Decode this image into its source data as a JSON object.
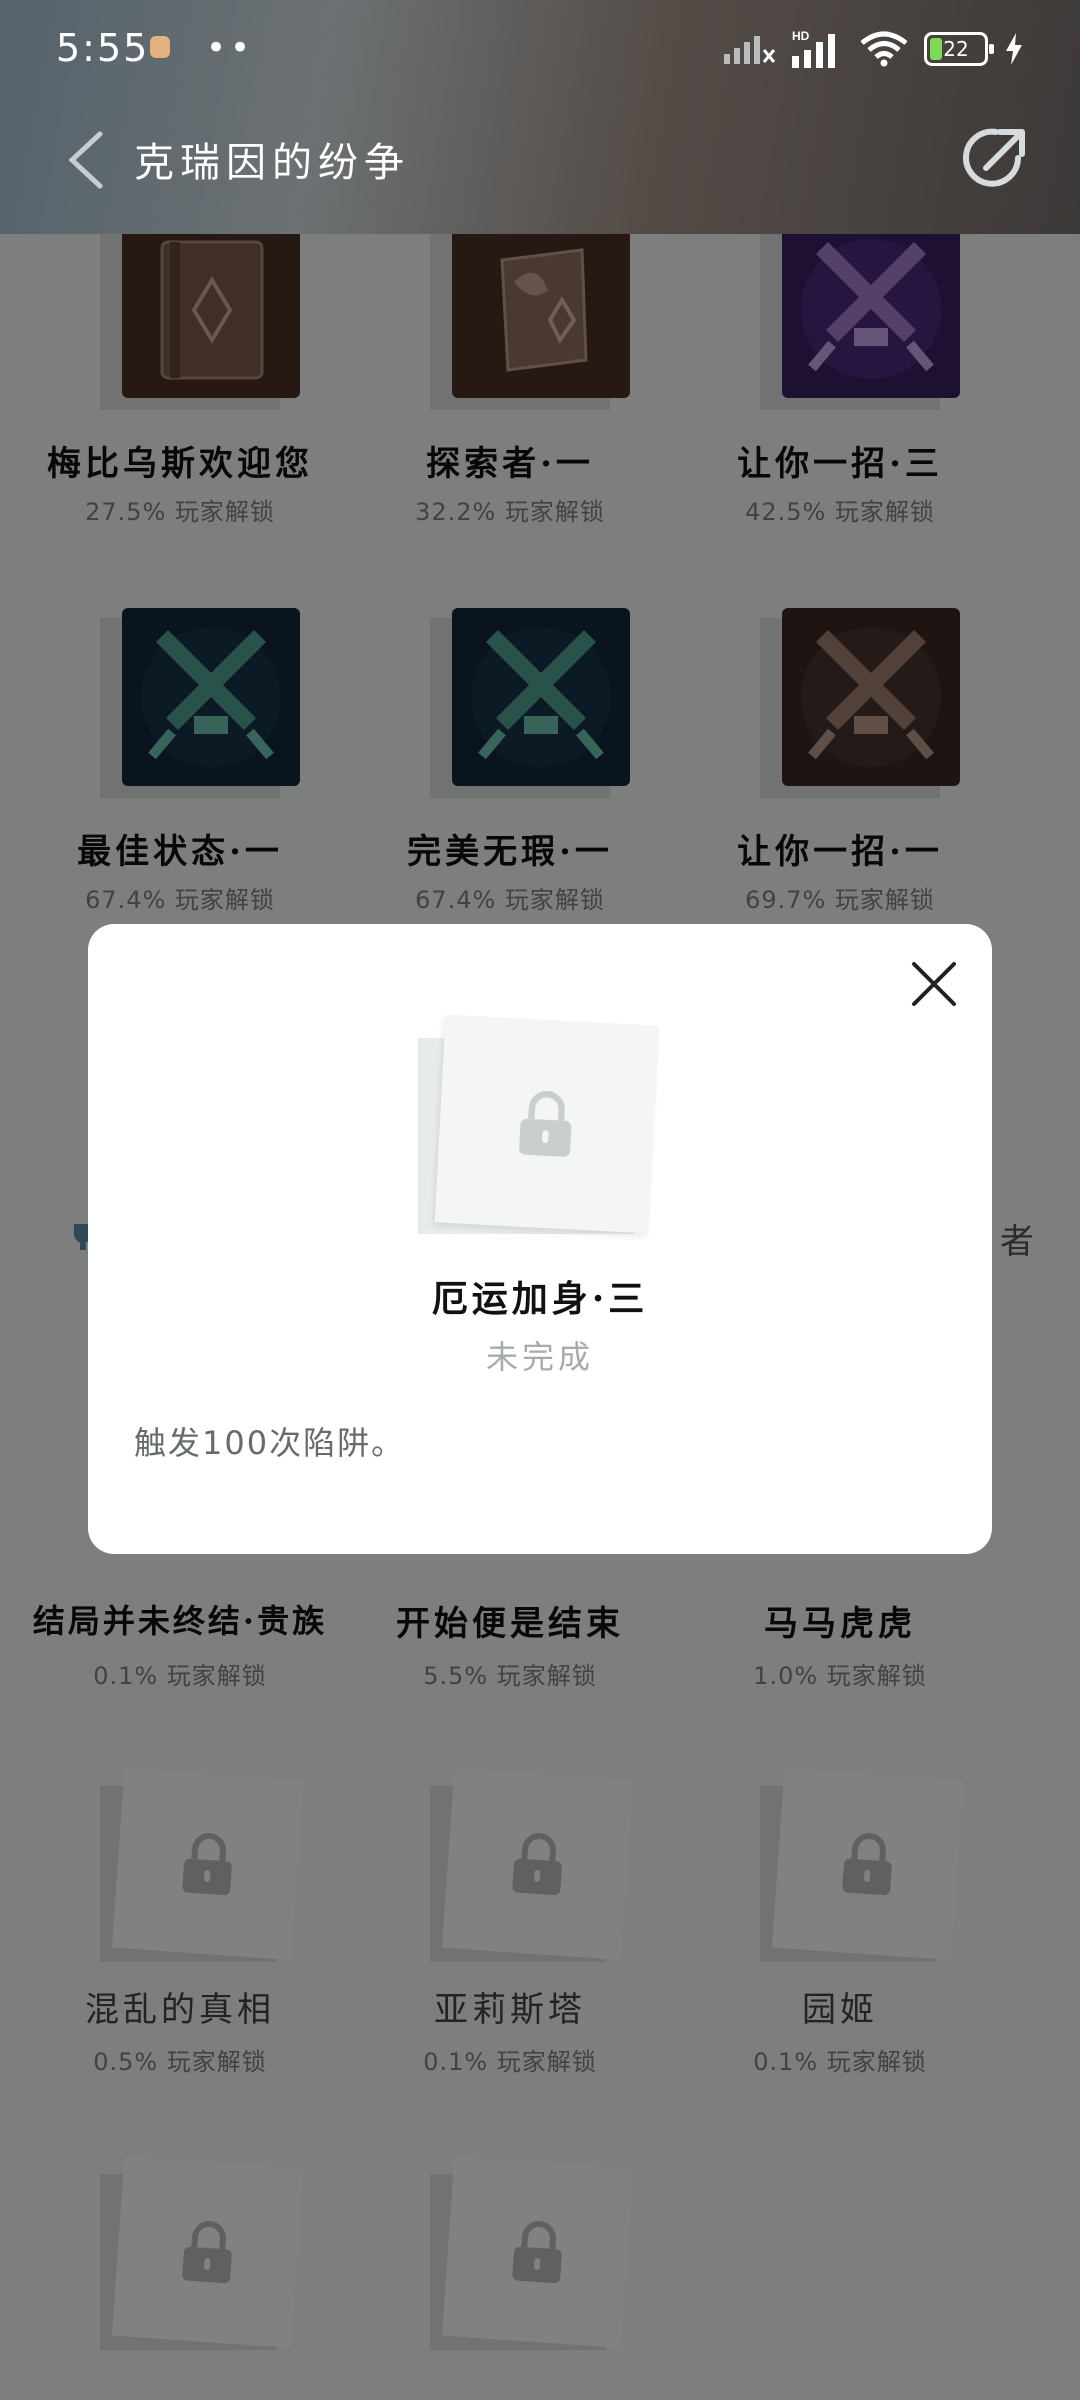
{
  "status_bar": {
    "time": "5:55",
    "dots": "••",
    "hd_label": "HD",
    "battery": "22"
  },
  "header": {
    "title": "克瑞因的纷争",
    "back_icon": "chevron-left-icon",
    "share_icon": "share-icon"
  },
  "achievements": [
    {
      "name": "梅比乌斯欢迎您",
      "percent": "27.5% 玩家解锁",
      "icon": "book-icon",
      "state": "unlocked",
      "color": "#4a3128"
    },
    {
      "name": "探索者·一",
      "percent": "32.2% 玩家解锁",
      "icon": "scroll-icon",
      "state": "unlocked",
      "color": "#4a3128"
    },
    {
      "name": "让你一招·三",
      "percent": "42.5% 玩家解锁",
      "icon": "crossed-swords-icon",
      "state": "unlocked",
      "color": "#3a1f63"
    },
    {
      "name": "最佳状态·一",
      "percent": "67.4% 玩家解锁",
      "icon": "crossed-swords-icon",
      "state": "unlocked",
      "color": "#12283a"
    },
    {
      "name": "完美无瑕·一",
      "percent": "67.4% 玩家解锁",
      "icon": "crossed-swords-icon",
      "state": "unlocked",
      "color": "#12283a"
    },
    {
      "name": "让你一招·一",
      "percent": "69.7% 玩家解锁",
      "icon": "crossed-swords-icon",
      "state": "unlocked",
      "color": "#3a2a24"
    },
    {
      "name": "结局并未终结·贵族",
      "percent": "0.1% 玩家解锁",
      "icon": "lock-icon",
      "state": "locked"
    },
    {
      "name": "开始便是结束",
      "percent": "5.5% 玩家解锁",
      "icon": "lock-icon",
      "state": "locked"
    },
    {
      "name": "马马虎虎",
      "percent": "1.0% 玩家解锁",
      "icon": "lock-icon",
      "state": "locked"
    },
    {
      "name": "混乱的真相",
      "percent": "0.5% 玩家解锁",
      "icon": "lock-icon",
      "state": "locked"
    },
    {
      "name": "亚莉斯塔",
      "percent": "0.1% 玩家解锁",
      "icon": "lock-icon",
      "state": "locked"
    },
    {
      "name": "园姬",
      "percent": "0.1% 玩家解锁",
      "icon": "lock-icon",
      "state": "locked"
    },
    {
      "name": "",
      "percent": "",
      "icon": "lock-icon",
      "state": "locked"
    },
    {
      "name": "",
      "percent": "",
      "icon": "lock-icon",
      "state": "locked"
    }
  ],
  "partial_labels": {
    "right_edge": "者"
  },
  "dialog": {
    "title": "厄运加身·三",
    "status": "未完成",
    "description": "触发100次陷阱。",
    "close_icon": "close-icon",
    "badge_icon": "lock-icon"
  },
  "colors": {
    "overlay": "#000000",
    "locked_card": "#f6f7f7",
    "battery_level": "#7ed957",
    "muted_text": "#7c8083"
  }
}
